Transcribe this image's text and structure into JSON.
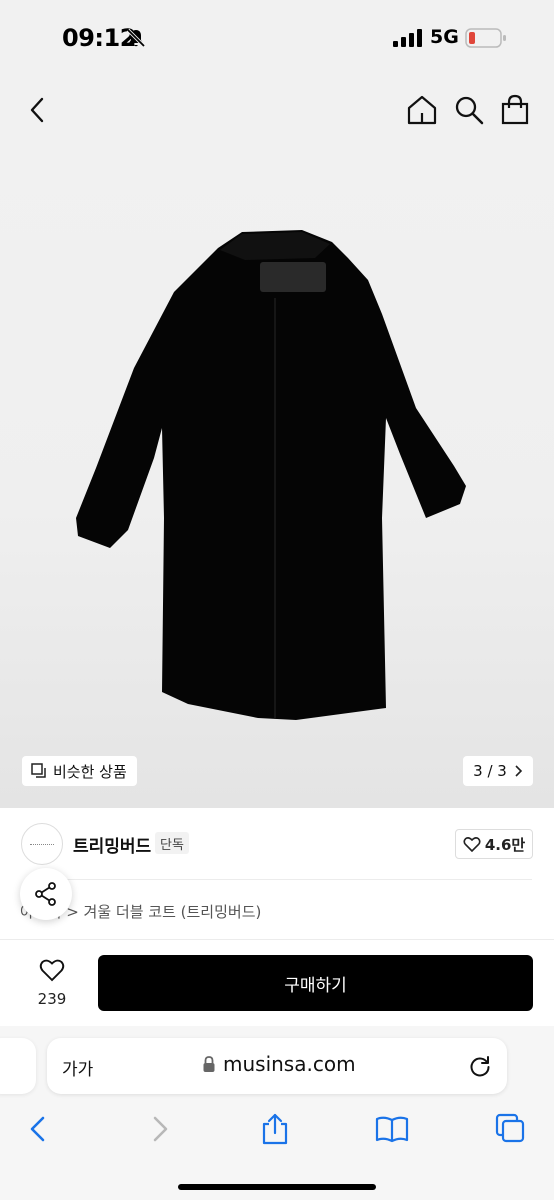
{
  "status": {
    "time": "09:12",
    "network": "5G"
  },
  "nav": {
    "back": "back-icon",
    "home": "home-icon",
    "search": "search-icon",
    "bag": "bag-icon"
  },
  "gallery": {
    "similar_label": "비슷한 상품",
    "page": "3 / 3"
  },
  "brand": {
    "name": "트리밍버드",
    "badge": "단독",
    "likes": "4.6만"
  },
  "breadcrumb": {
    "visible_prefix": "아우터",
    "title": "겨울 더블 코트 (트리밍버드)"
  },
  "purchase": {
    "wish_count": "239",
    "buy_label": "구매하기"
  },
  "browser": {
    "text_size": "가가",
    "url": "musinsa.com"
  },
  "colors": {
    "accent": "#000000",
    "safari_blue": "#1a73e8",
    "battery_low": "#e0463a"
  }
}
